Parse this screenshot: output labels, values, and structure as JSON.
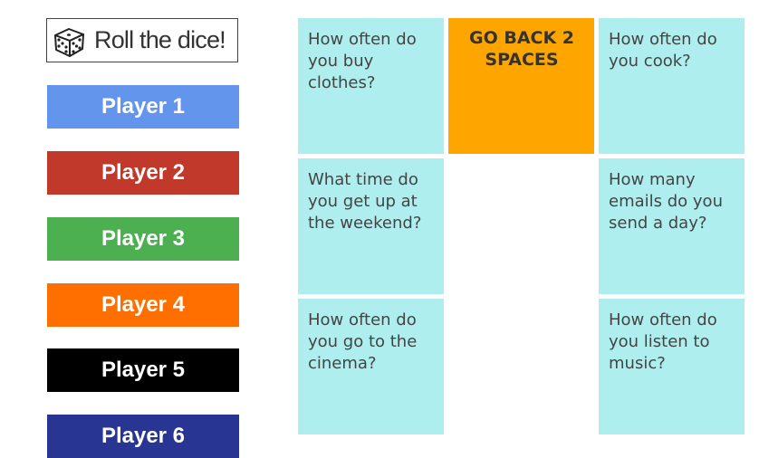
{
  "roll_button": {
    "label": "Roll the dice!",
    "icon": "dice-icon"
  },
  "players": [
    {
      "label": "Player 1",
      "color": "#6495ed"
    },
    {
      "label": "Player 2",
      "color": "#c0392b"
    },
    {
      "label": "Player 3",
      "color": "#4caf50"
    },
    {
      "label": "Player 4",
      "color": "#ff6f00"
    },
    {
      "label": "Player 5",
      "color": "#000000"
    },
    {
      "label": "Player 6",
      "color": "#283593"
    }
  ],
  "board": {
    "tile_color": "#afeeee",
    "special_color": "#ffa500",
    "tiles": [
      {
        "text": "How often do you buy clothes?"
      },
      {
        "text": "GO BACK 2 SPACES"
      },
      {
        "text": "How often do you cook?"
      },
      {
        "text": "What time do you get up at the weekend?"
      },
      {
        "text": "How many emails do you send a day?"
      },
      {
        "text": "How often do you go to the cinema?"
      },
      {
        "text": "How often do you listen to music?"
      }
    ]
  }
}
